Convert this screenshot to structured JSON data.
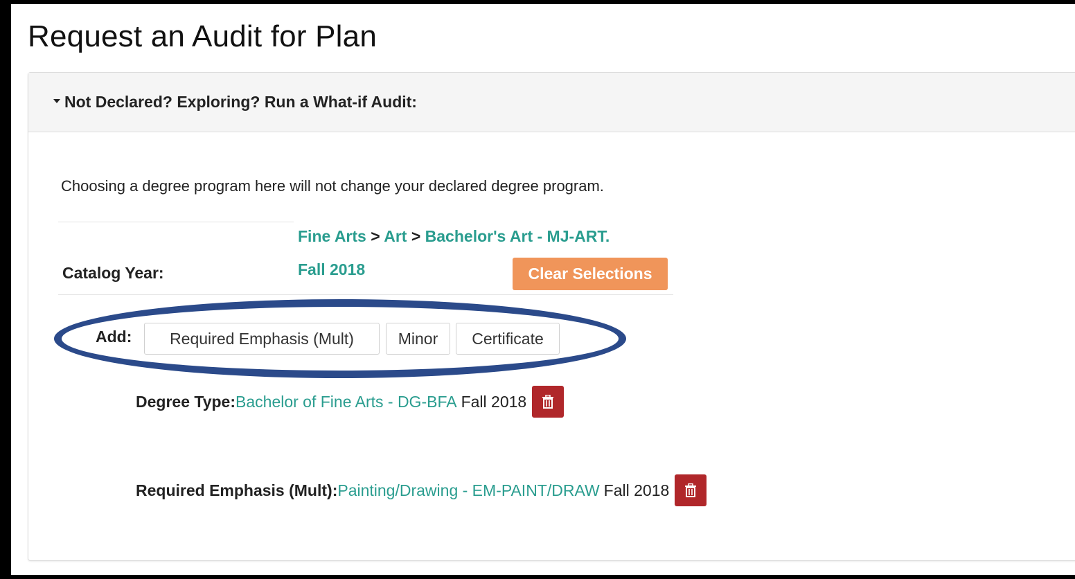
{
  "page": {
    "title": "Request an Audit for Plan"
  },
  "whatif": {
    "header": "Not Declared? Exploring? Run a What-if Audit:",
    "intro": "Choosing a degree program here will not change your declared degree program.",
    "breadcrumb": [
      "Fine Arts",
      "Art",
      "Bachelor's Art - MJ-ART."
    ],
    "breadcrumb_separator": ">",
    "catalog_label": "Catalog Year:",
    "catalog_value": "Fall 2018",
    "clear_label": "Clear Selections",
    "add_label": "Add:",
    "add_buttons": [
      "Required Emphasis (Mult)",
      "Minor",
      "Certificate"
    ],
    "selections": [
      {
        "label": "Degree Type:",
        "value": "Bachelor of Fine Arts - DG-BFA",
        "term": "Fall 2018"
      },
      {
        "label": "Required Emphasis (Mult):",
        "value": "Painting/Drawing - EM-PAINT/DRAW",
        "term": "Fall 2018"
      }
    ]
  },
  "colors": {
    "link": "#2a9d8f",
    "clear_button": "#f0955a",
    "delete_button": "#b0272a",
    "highlight_oval": "#2b4a8a"
  },
  "icons": {
    "caret": "caret-down-icon",
    "delete": "trash-icon"
  }
}
